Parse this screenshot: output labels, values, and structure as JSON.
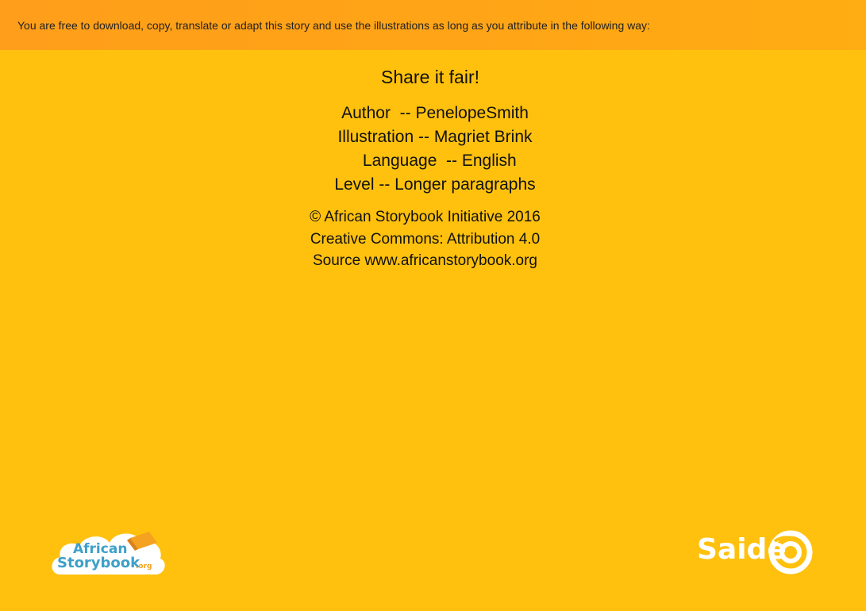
{
  "banner": {
    "text": "You are free to download, copy, translate or adapt this story and use the illustrations as long as you attribute in the following way:"
  },
  "main": {
    "title": "Share it fair!",
    "credits": [
      "Author  -- PenelopeSmith",
      "Illustration -- Magriet Brink",
      "  Language  -- English",
      "Level -- Longer paragraphs"
    ],
    "copyright": [
      "© African Storybook Initiative 2016",
      "Creative Commons: Attribution 4.0",
      "Source www.africanstorybook.org"
    ]
  },
  "logos": {
    "left": {
      "line1": "African",
      "line2": "Storybook",
      "suffix": ".org"
    },
    "right": {
      "word": "Saide"
    }
  },
  "colors": {
    "background": "#ffc10e",
    "banner": "#ffa516",
    "logo_blue": "#3ea0c8",
    "logo_white": "#ffffff"
  }
}
